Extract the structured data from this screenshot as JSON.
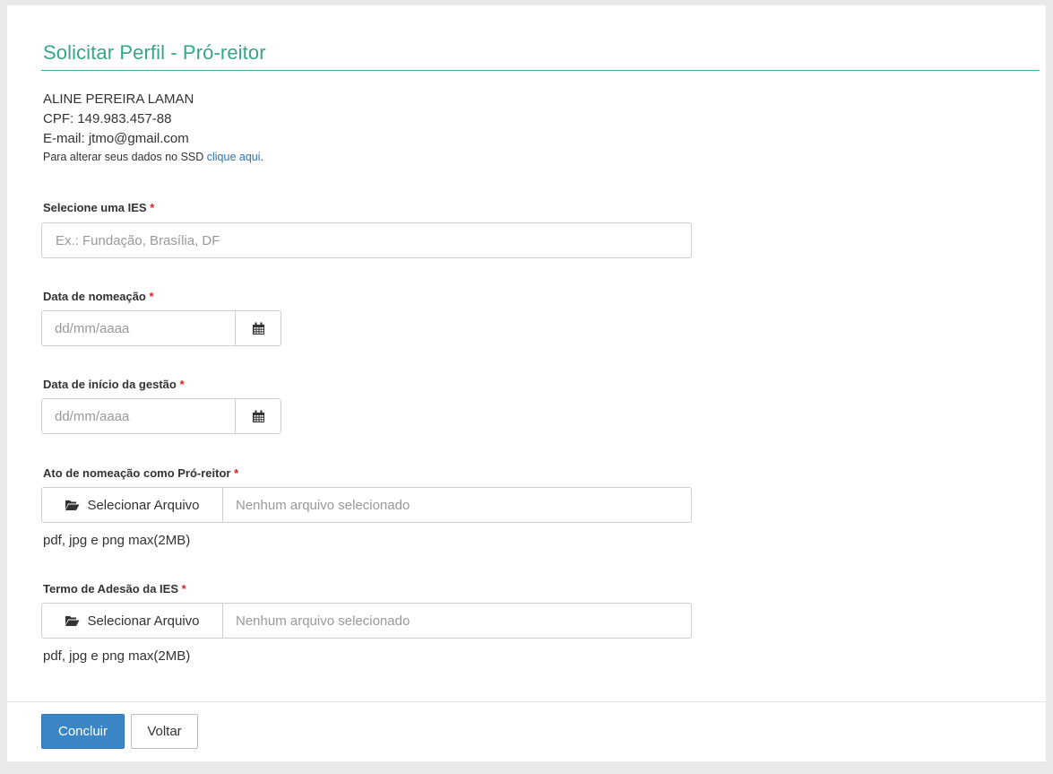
{
  "page": {
    "title": "Solicitar Perfil - Pró-reitor"
  },
  "user": {
    "name": "ALINE PEREIRA LAMAN",
    "cpf": "CPF: 149.983.457-88",
    "email": "E-mail: jtmo@gmail.com",
    "change_data_text": "Para alterar seus dados no SSD ",
    "change_data_link": "clique aqui",
    "change_data_suffix": "."
  },
  "required_mark": "*",
  "fields": {
    "ies": {
      "label": "Selecione uma IES",
      "placeholder": "Ex.: Fundação, Brasília, DF"
    },
    "data_nomeacao": {
      "label": "Data de nomeação",
      "placeholder": "dd/mm/aaaa"
    },
    "data_inicio": {
      "label": "Data de início da gestão",
      "placeholder": "dd/mm/aaaa"
    },
    "ato_nomeacao": {
      "label": "Ato de nomeação como Pró-reitor",
      "button_label": "Selecionar Arquivo",
      "file_status": "Nenhum arquivo selecionado",
      "hint": "pdf, jpg e png max(2MB)"
    },
    "termo_adesao": {
      "label": "Termo de Adesão da IES",
      "button_label": "Selecionar Arquivo",
      "file_status": "Nenhum arquivo selecionado",
      "hint": "pdf, jpg e png max(2MB)"
    }
  },
  "actions": {
    "submit_label": "Concluir",
    "back_label": "Voltar"
  },
  "colors": {
    "title": "#35a58b",
    "primary_button": "#3d86c6",
    "required": "#d9241c",
    "link": "#2b73b8"
  }
}
